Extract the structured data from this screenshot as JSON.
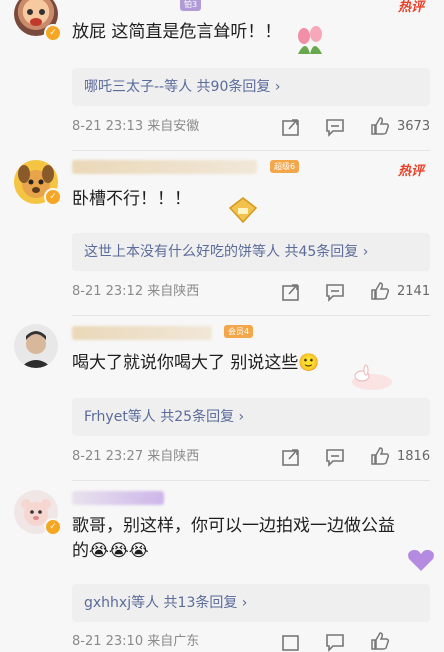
{
  "comments": [
    {
      "level_badge": "铂3",
      "hot_label": "热评",
      "text": "放屁 这简直是危言耸听！！",
      "reply_summary": "哪吒三太子--等人 共90条回复 ›",
      "timestamp": "8-21 23:13",
      "location": "来自安徽",
      "likes": "3673",
      "avatar_icon": "cartoon-face-avatar",
      "sticker_icon": "tulip-sticker"
    },
    {
      "level_badge": "超级6",
      "hot_label": "热评",
      "text": "卧槽不行！！！",
      "reply_summary": "这世上本没有什么好吃的饼等人 共45条回复 ›",
      "timestamp": "8-21 23:12",
      "location": "来自陕西",
      "likes": "2141",
      "avatar_icon": "cartoon-dog-avatar",
      "sticker_icon": "gold-badge-sticker"
    },
    {
      "level_badge": "会员4",
      "text": "喝大了就说你喝大了 别说这些🙂",
      "reply_summary": "Frhyet等人 共25条回复 ›",
      "timestamp": "8-21 23:27",
      "location": "来自陕西",
      "likes": "1816",
      "avatar_icon": "man-portrait-avatar",
      "sticker_icon": "bunny-sticker"
    },
    {
      "text_line1": "歌哥，别这样，你可以一边拍戏一边做公益",
      "text_line2": "的😭😭😭",
      "reply_summary": "gxhhxj等人 共13条回复 ›",
      "timestamp": "8-21 23:10",
      "location": "来自广东",
      "avatar_icon": "cartoon-bear-avatar",
      "sticker_icon": "purple-heart-sticker"
    }
  ],
  "icons": {
    "share": "share-icon",
    "comment": "comment-icon",
    "like": "thumbs-up-icon"
  },
  "colors": {
    "link": "#5b6b9a",
    "hot": "#e8422b",
    "badge": "#f3a64a"
  }
}
